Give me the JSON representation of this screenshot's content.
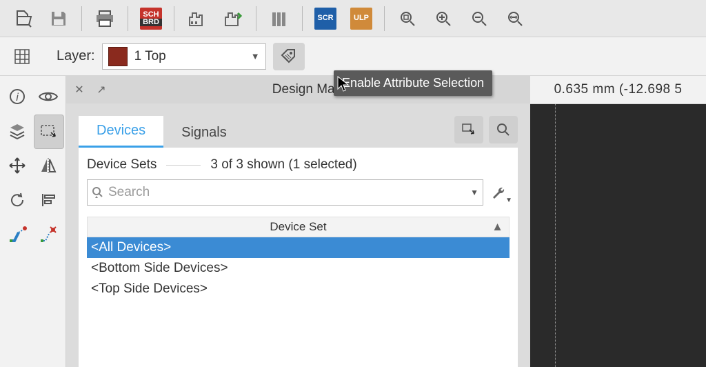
{
  "toolbar": {
    "badges": {
      "sch_top": "SCH",
      "sch_bot": "BRD",
      "scr": "SCR",
      "ulp": "ULP"
    }
  },
  "layerbar": {
    "label": "Layer:",
    "selected": "1 Top",
    "swatch": "#8a2a1e",
    "tag_tooltip": "Enable Attribute Selection"
  },
  "panel": {
    "title": "Design Manager",
    "tabs": [
      {
        "label": "Devices",
        "active": true
      },
      {
        "label": "Signals",
        "active": false
      }
    ]
  },
  "device_sets": {
    "label": "Device Sets",
    "count": "3 of 3 shown (1 selected)",
    "search_placeholder": "Search",
    "header": "Device Set",
    "items": [
      {
        "label": "<All Devices>",
        "selected": true
      },
      {
        "label": "<Bottom Side Devices>",
        "selected": false
      },
      {
        "label": "<Top Side Devices>",
        "selected": false
      }
    ]
  },
  "status": {
    "coord": "0.635 mm (-12.698 5"
  }
}
